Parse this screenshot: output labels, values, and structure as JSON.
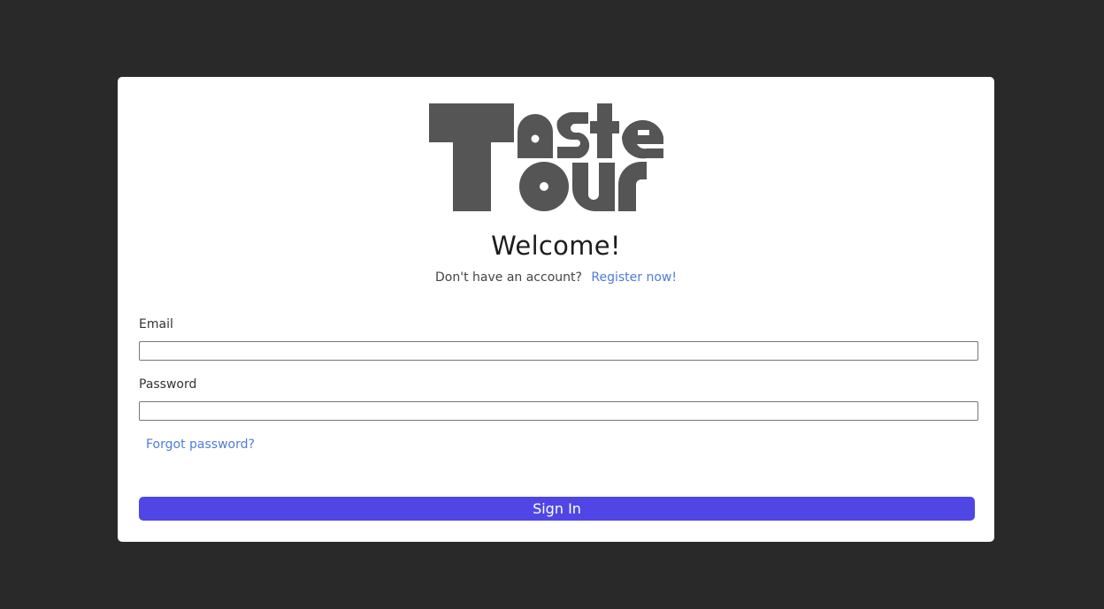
{
  "brand": {
    "logo_text": "Taste Tour",
    "logo_color": "#555555"
  },
  "header": {
    "welcome": "Welcome!",
    "no_account_text": "Don't have an account?",
    "register_link": "Register now!"
  },
  "form": {
    "email_label": "Email",
    "email_value": "",
    "password_label": "Password",
    "password_value": "",
    "forgot_link": "Forgot password?",
    "submit_label": "Sign In"
  },
  "colors": {
    "background": "#292929",
    "card": "#ffffff",
    "accent": "#4f46e5",
    "link": "#4f7bdc"
  }
}
